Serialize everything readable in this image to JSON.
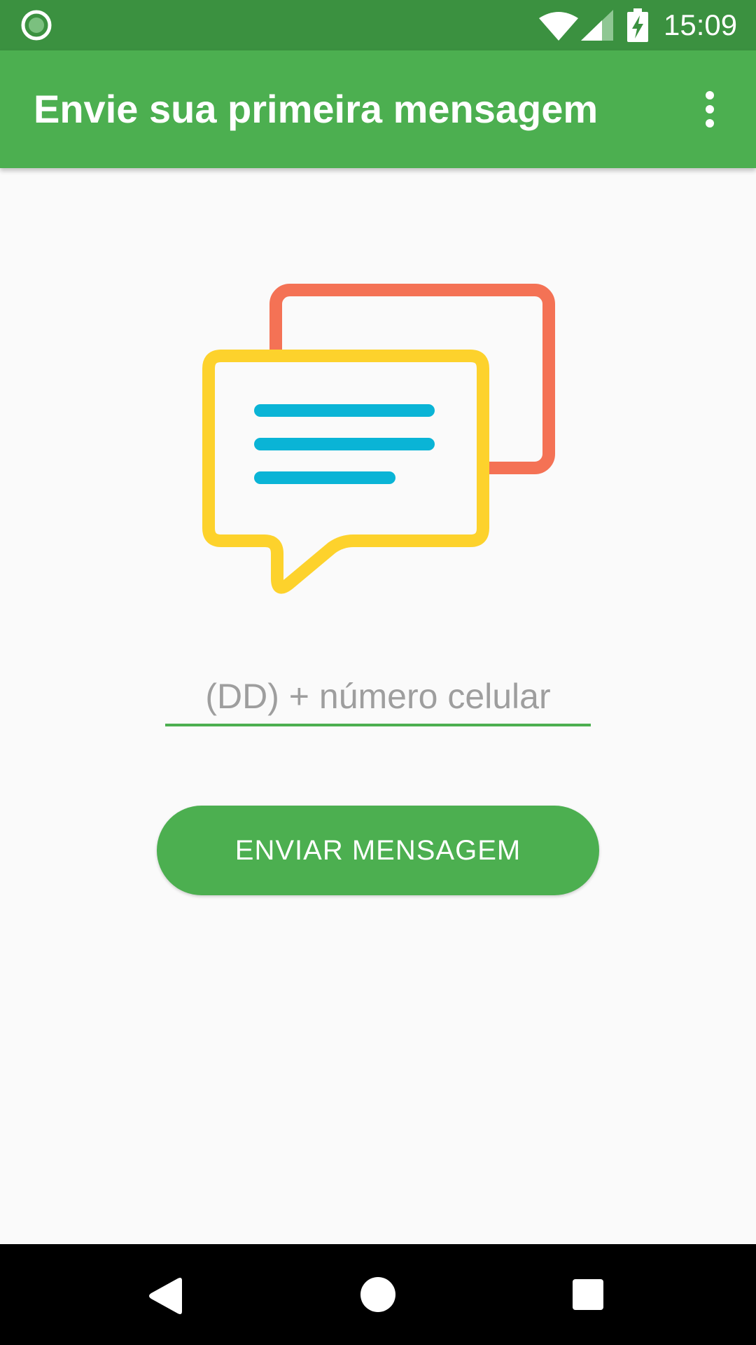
{
  "status_bar": {
    "time": "15:09",
    "icons": [
      "notification-dot-icon",
      "wifi-icon",
      "cell-signal-icon",
      "battery-charging-icon"
    ]
  },
  "app_bar": {
    "title": "Envie sua primeira mensagem",
    "menu_icon": "more-vert-icon"
  },
  "illustration": {
    "icon": "chat-bubbles-icon",
    "colors": {
      "back_bubble": "#f47255",
      "front_bubble": "#fdd22c",
      "text_lines": "#0ab4d6"
    }
  },
  "phone_input": {
    "value": "",
    "placeholder": "(DD) + número celular"
  },
  "send_button": {
    "label": "ENVIAR MENSAGEM"
  },
  "nav_bar": {
    "icons": [
      "back-icon",
      "home-icon",
      "recents-icon"
    ]
  },
  "colors": {
    "status_bar": "#3b9140",
    "primary": "#4caf50",
    "background": "#fafafa",
    "hint_text": "#9e9e9e"
  }
}
